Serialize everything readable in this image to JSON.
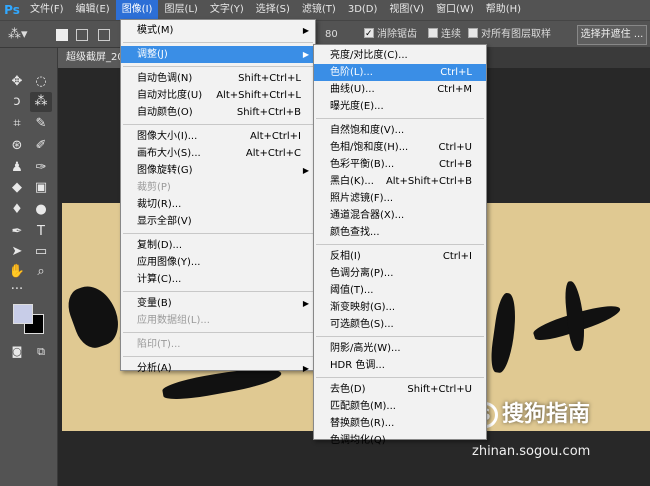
{
  "menubar": {
    "logo": "Ps",
    "items": [
      "文件(F)",
      "编辑(E)",
      "图像(I)",
      "图层(L)",
      "文字(Y)",
      "选择(S)",
      "滤镜(T)",
      "3D(D)",
      "视图(V)",
      "窗口(W)",
      "帮助(H)"
    ]
  },
  "options": {
    "tolerance": "80",
    "antialias": "消除锯齿",
    "contiguous": "连续",
    "all_layers": "对所有图层取样",
    "select_button": "选择并遮住 ..."
  },
  "tab": {
    "title": "超级截屏_20"
  },
  "image_menu": {
    "items": [
      {
        "label": "模式(M)",
        "shortcut": "",
        "submenu": true
      },
      {
        "label": "调整(J)",
        "shortcut": "",
        "submenu": true
      },
      {
        "label": "自动色调(N)",
        "shortcut": "Shift+Ctrl+L"
      },
      {
        "label": "自动对比度(U)",
        "shortcut": "Alt+Shift+Ctrl+L"
      },
      {
        "label": "自动颜色(O)",
        "shortcut": "Shift+Ctrl+B"
      },
      {
        "label": "图像大小(I)...",
        "shortcut": "Alt+Ctrl+I"
      },
      {
        "label": "画布大小(S)...",
        "shortcut": "Alt+Ctrl+C"
      },
      {
        "label": "图像旋转(G)",
        "shortcut": "",
        "submenu": true
      },
      {
        "label": "裁剪(P)",
        "shortcut": ""
      },
      {
        "label": "裁切(R)...",
        "shortcut": ""
      },
      {
        "label": "显示全部(V)",
        "shortcut": ""
      },
      {
        "label": "复制(D)...",
        "shortcut": ""
      },
      {
        "label": "应用图像(Y)...",
        "shortcut": ""
      },
      {
        "label": "计算(C)...",
        "shortcut": ""
      },
      {
        "label": "变量(B)",
        "shortcut": "",
        "submenu": true
      },
      {
        "label": "应用数据组(L)...",
        "shortcut": ""
      },
      {
        "label": "陷印(T)...",
        "shortcut": ""
      },
      {
        "label": "分析(A)",
        "shortcut": "",
        "submenu": true
      }
    ]
  },
  "adjust_menu": {
    "items": [
      {
        "label": "亮度/对比度(C)...",
        "shortcut": ""
      },
      {
        "label": "色阶(L)...",
        "shortcut": "Ctrl+L"
      },
      {
        "label": "曲线(U)...",
        "shortcut": "Ctrl+M"
      },
      {
        "label": "曝光度(E)...",
        "shortcut": ""
      },
      {
        "label": "自然饱和度(V)...",
        "shortcut": ""
      },
      {
        "label": "色相/饱和度(H)...",
        "shortcut": "Ctrl+U"
      },
      {
        "label": "色彩平衡(B)...",
        "shortcut": "Ctrl+B"
      },
      {
        "label": "黑白(K)...",
        "shortcut": "Alt+Shift+Ctrl+B"
      },
      {
        "label": "照片滤镜(F)...",
        "shortcut": ""
      },
      {
        "label": "通道混合器(X)...",
        "shortcut": ""
      },
      {
        "label": "颜色查找...",
        "shortcut": ""
      },
      {
        "label": "反相(I)",
        "shortcut": "Ctrl+I"
      },
      {
        "label": "色调分离(P)...",
        "shortcut": ""
      },
      {
        "label": "阈值(T)...",
        "shortcut": ""
      },
      {
        "label": "渐变映射(G)...",
        "shortcut": ""
      },
      {
        "label": "可选颜色(S)...",
        "shortcut": ""
      },
      {
        "label": "阴影/高光(W)...",
        "shortcut": ""
      },
      {
        "label": "HDR 色调...",
        "shortcut": ""
      },
      {
        "label": "去色(D)",
        "shortcut": "Shift+Ctrl+U"
      },
      {
        "label": "匹配颜色(M)...",
        "shortcut": ""
      },
      {
        "label": "替换颜色(R)...",
        "shortcut": ""
      },
      {
        "label": "色调均化(Q)",
        "shortcut": ""
      }
    ]
  },
  "watermark": {
    "brand": "搜狗指南",
    "url": "zhinan.sogou.com"
  },
  "colors": {
    "highlight": "#3a8ee6",
    "menubar": "#535353",
    "paper": "#e0c992"
  }
}
